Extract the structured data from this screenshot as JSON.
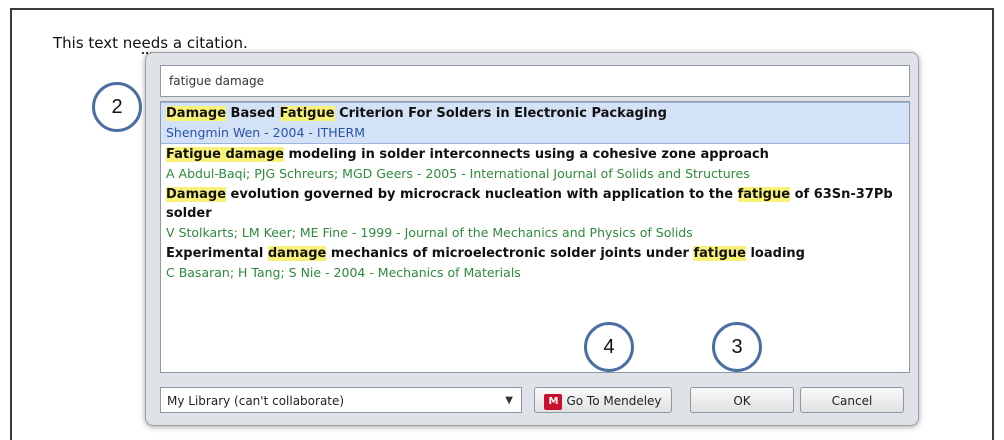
{
  "document": {
    "text_before": "This text ne",
    "text_underlined": "eds a citation.",
    "text_after": ""
  },
  "dialog": {
    "search_value": "fatigue damage",
    "results": [
      {
        "title_parts": [
          {
            "t": "Damage",
            "hl": true
          },
          {
            "t": " Based ",
            "hl": false
          },
          {
            "t": "Fatigue",
            "hl": true
          },
          {
            "t": " Criterion For Solders in Electronic Packaging",
            "hl": false
          }
        ],
        "meta": "Shengmin Wen - 2004 - ITHERM",
        "selected": true
      },
      {
        "title_parts": [
          {
            "t": "Fatigue damage",
            "hl": true
          },
          {
            "t": " modeling in solder interconnects using a cohesive zone approach",
            "hl": false
          }
        ],
        "meta": "A Abdul-Baqi; PJG Schreurs; MGD Geers - 2005 - International Journal of Solids and Structures",
        "selected": false
      },
      {
        "title_parts": [
          {
            "t": "Damage",
            "hl": true
          },
          {
            "t": " evolution governed by microcrack nucleation with application to the ",
            "hl": false
          },
          {
            "t": "fatigue",
            "hl": true
          },
          {
            "t": " of 63Sn-37Pb solder",
            "hl": false
          }
        ],
        "meta": "V Stolkarts; LM Keer; ME Fine - 1999 - Journal of the Mechanics and Physics of Solids",
        "selected": false
      },
      {
        "title_parts": [
          {
            "t": "Experimental ",
            "hl": false
          },
          {
            "t": "damage",
            "hl": true
          },
          {
            "t": " mechanics of microelectronic solder joints under ",
            "hl": false
          },
          {
            "t": "fatigue",
            "hl": true
          },
          {
            "t": " loading",
            "hl": false
          }
        ],
        "meta": "C Basaran; H Tang; S Nie - 2004 - Mechanics of Materials",
        "selected": false
      }
    ],
    "library_select": "My Library (can't collaborate)",
    "mendeley_button": "Go To Mendeley",
    "mendeley_icon": "M",
    "ok_button": "OK",
    "cancel_button": "Cancel"
  },
  "callouts": {
    "c2": "2",
    "c3": "3",
    "c4": "4"
  },
  "colors": {
    "highlight": "#f8f27a",
    "selected_row": "#d4e2f7",
    "meta_green": "#2f8a3c",
    "callout_border": "#4b6ea3",
    "mendeley_red": "#c8102e"
  }
}
